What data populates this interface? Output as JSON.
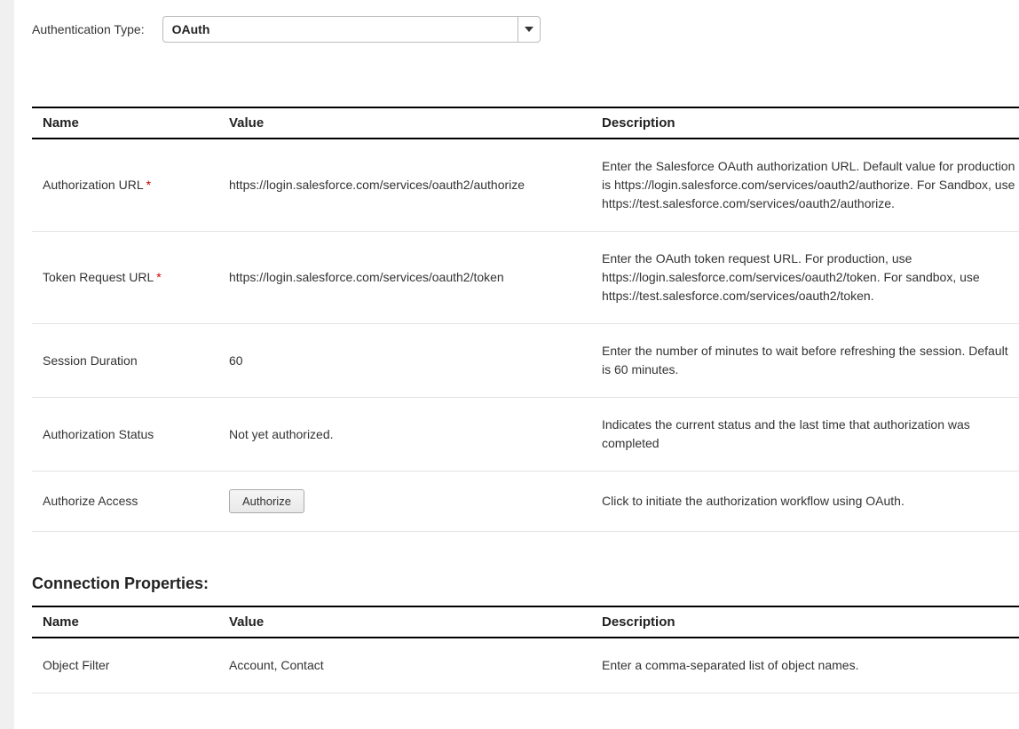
{
  "auth_type": {
    "label": "Authentication Type:",
    "value": "OAuth"
  },
  "headers": {
    "name": "Name",
    "value": "Value",
    "description": "Description"
  },
  "auth_rows": [
    {
      "name": "Authorization URL",
      "required": true,
      "value": "https://login.salesforce.com/services/oauth2/authorize",
      "description": "Enter the Salesforce OAuth authorization URL. Default value for production is https://login.salesforce.com/services/oauth2/authorize. For Sandbox, use https://test.salesforce.com/services/oauth2/authorize."
    },
    {
      "name": "Token Request URL",
      "required": true,
      "value": "https://login.salesforce.com/services/oauth2/token",
      "description": "Enter the OAuth token request URL. For production, use https://login.salesforce.com/services/oauth2/token. For sandbox, use https://test.salesforce.com/services/oauth2/token."
    },
    {
      "name": "Session Duration",
      "required": false,
      "value": "60",
      "description": "Enter the number of minutes to wait before refreshing the session. Default is 60 minutes."
    },
    {
      "name": "Authorization Status",
      "required": false,
      "value": "Not yet authorized.",
      "description": "Indicates the current status and the last time that authorization was completed"
    },
    {
      "name": "Authorize Access",
      "required": false,
      "button": "Authorize",
      "description": "Click to initiate the authorization workflow using OAuth."
    }
  ],
  "conn_section_title": "Connection Properties:",
  "conn_rows": [
    {
      "name": "Object Filter",
      "value": "Account, Contact",
      "description": "Enter a comma-separated list of object names."
    }
  ]
}
